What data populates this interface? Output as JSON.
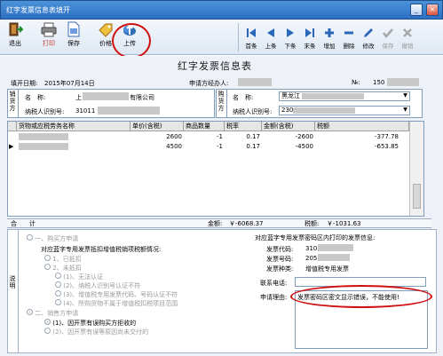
{
  "window": {
    "title": "红字发票信息表填开"
  },
  "toolbar": {
    "left_buttons": [
      {
        "label": "退出",
        "icon": "exit-icon"
      },
      {
        "label": "打印",
        "icon": "printer-icon"
      },
      {
        "label": "保存",
        "icon": "save-icon"
      },
      {
        "label": "价格",
        "icon": "price-icon"
      },
      {
        "label": "上传",
        "icon": "upload-icon"
      }
    ],
    "right_buttons": [
      {
        "label": "首条",
        "icon": "first-record-icon"
      },
      {
        "label": "上条",
        "icon": "prev-record-icon"
      },
      {
        "label": "下条",
        "icon": "next-record-icon"
      },
      {
        "label": "末条",
        "icon": "last-record-icon"
      },
      {
        "label": "增加",
        "icon": "add-icon"
      },
      {
        "label": "删除",
        "icon": "delete-icon"
      },
      {
        "label": "修改",
        "icon": "edit-icon"
      },
      {
        "label": "保存",
        "icon": "save-record-icon"
      },
      {
        "label": "撤销",
        "icon": "undo-icon"
      }
    ]
  },
  "form": {
    "title": "红字发票信息表",
    "fill_date_label": "填开日期:",
    "fill_date": "2015年07月14日",
    "applicant_label": "申请方经办人:",
    "no_label": "№:",
    "no_value": "150"
  },
  "seller": {
    "side_label": "销货方",
    "name_label": "名　称:",
    "name_value": "上",
    "name_suffix": "有限公司",
    "tax_label": "纳税人识别号:",
    "tax_value": "31011"
  },
  "buyer": {
    "side_label": "购货方",
    "name_label": "名　称:",
    "name_value": "黑龙江",
    "tax_label": "纳税人识别号:",
    "tax_value": "230"
  },
  "grid": {
    "columns": [
      "货物或应税劳务名称",
      "单价(含税)",
      "商品数量",
      "税率",
      "金额(含税)",
      "税额"
    ],
    "rows": [
      {
        "name": "",
        "price": "2600",
        "qty": "-1",
        "rate": "0.17",
        "amount": "-2600",
        "tax": "-377.78"
      },
      {
        "name": "",
        "price": "4500",
        "qty": "-1",
        "rate": "0.17",
        "amount": "-4500",
        "tax": "-653.85"
      }
    ]
  },
  "summary": {
    "heji_label": "合　　计",
    "amount_label": "金额:",
    "amount_value": "￥-6068.37",
    "tax_label": "税额:",
    "tax_value": "￥-1031.63"
  },
  "explain": {
    "side_label": "说明",
    "buyer_apply": "一、购买方申请",
    "buyer_desc": "对应蓝字专用发票抵扣增值税销项税额情况:",
    "deducted": "1、已抵扣",
    "not_deducted": "2、未抵扣",
    "sub_options": [
      "(1)、无法认证",
      "(2)、纳税人识别号认证不符",
      "(3)、增值税专用发票代码、号码认证不符",
      "(4)、所购货物不属于增值税扣税项目范围"
    ],
    "seller_apply": "二、销售方申请",
    "seller_options": [
      "(1)、因开票有误购买方拒收的",
      "(2)、因开票有误等原因尚未交付的"
    ],
    "blue_info_title": "对应蓝字专用发票密码区内打印的发票信息:",
    "invoice_code_label": "发票代码:",
    "invoice_code_value": "310",
    "invoice_no_label": "发票号码:",
    "invoice_no_value": "205",
    "invoice_type_label": "发票种类:",
    "invoice_type_value": "增值税专用发票",
    "phone_label": "联系电话:",
    "reason_label": "申请理由:",
    "reason_value": "发票密码区密文显示错误，不能使用!"
  },
  "colors": {
    "titlebar": "#2d6fc4",
    "highlight": "#d01010",
    "panel": "#eef2f8"
  }
}
